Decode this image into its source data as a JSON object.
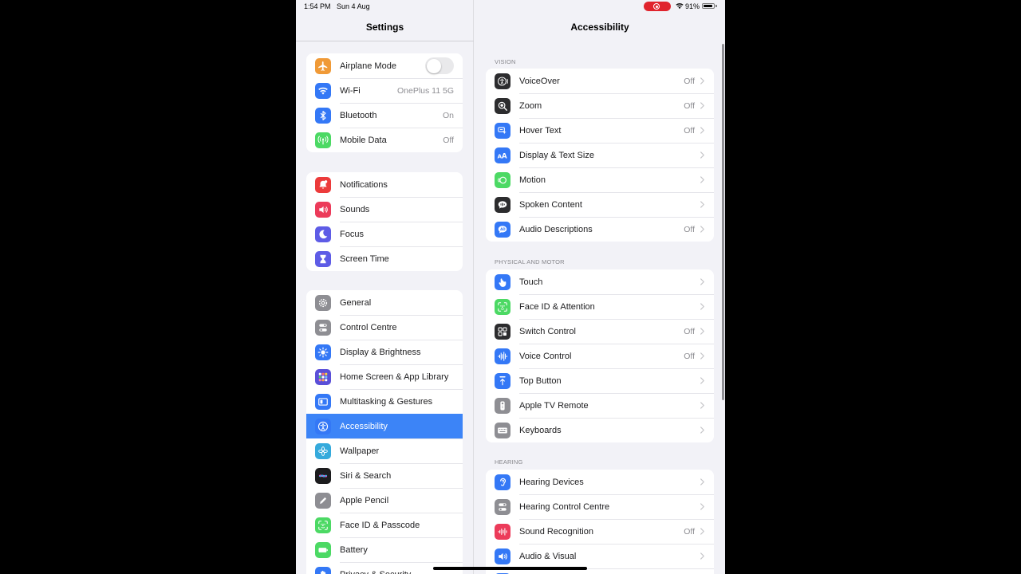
{
  "status_bar": {
    "time": "1:54 PM",
    "date": "Sun 4 Aug",
    "battery": "91%",
    "battery_level": 0.91
  },
  "sidebar": {
    "title": "Settings",
    "groups": [
      [
        {
          "name": "airplane-mode",
          "label": "Airplane Mode",
          "icon": "airplane-icon",
          "color": "#f09a37",
          "toggle": false
        },
        {
          "name": "wifi",
          "label": "Wi-Fi",
          "value": "OnePlus 11 5G",
          "icon": "wifi-icon",
          "color": "#3478f6"
        },
        {
          "name": "bluetooth",
          "label": "Bluetooth",
          "value": "On",
          "icon": "bluetooth-icon",
          "color": "#3478f6"
        },
        {
          "name": "mobile-data",
          "label": "Mobile Data",
          "value": "Off",
          "icon": "antenna-icon",
          "color": "#4cd964"
        }
      ],
      [
        {
          "name": "notifications",
          "label": "Notifications",
          "icon": "bell-icon",
          "color": "#ec3b3b"
        },
        {
          "name": "sounds",
          "label": "Sounds",
          "icon": "speaker-icon",
          "color": "#ec3b5a"
        },
        {
          "name": "focus",
          "label": "Focus",
          "icon": "moon-icon",
          "color": "#5e5ce6"
        },
        {
          "name": "screen-time",
          "label": "Screen Time",
          "icon": "hourglass-icon",
          "color": "#5e5ce6"
        }
      ],
      [
        {
          "name": "general",
          "label": "General",
          "icon": "gear-icon",
          "color": "#8e8e93"
        },
        {
          "name": "control-centre",
          "label": "Control Centre",
          "icon": "switches-icon",
          "color": "#8e8e93"
        },
        {
          "name": "display-brightness",
          "label": "Display & Brightness",
          "icon": "sun-icon",
          "color": "#3478f6"
        },
        {
          "name": "home-screen",
          "label": "Home Screen & App Library",
          "icon": "app-grid-icon",
          "color": "#5a4fd8"
        },
        {
          "name": "multitasking",
          "label": "Multitasking & Gestures",
          "icon": "multitask-icon",
          "color": "#3478f6"
        },
        {
          "name": "accessibility",
          "label": "Accessibility",
          "icon": "accessibility-icon",
          "color": "#3478f6",
          "selected": true
        },
        {
          "name": "wallpaper",
          "label": "Wallpaper",
          "icon": "flower-icon",
          "color": "#35aadc"
        },
        {
          "name": "siri-search",
          "label": "Siri & Search",
          "icon": "siri-icon",
          "color": "#1c1c1e"
        },
        {
          "name": "apple-pencil",
          "label": "Apple Pencil",
          "icon": "pencil-icon",
          "color": "#8e8e93"
        },
        {
          "name": "face-id-passcode",
          "label": "Face ID & Passcode",
          "icon": "face-id-icon",
          "color": "#4cd964"
        },
        {
          "name": "battery",
          "label": "Battery",
          "icon": "battery-icon",
          "color": "#4cd964"
        },
        {
          "name": "privacy-security",
          "label": "Privacy & Security",
          "icon": "hand-icon",
          "color": "#3478f6"
        }
      ]
    ]
  },
  "detail": {
    "title": "Accessibility",
    "sections": [
      {
        "header": "VISION",
        "rows": [
          {
            "name": "voiceover",
            "label": "VoiceOver",
            "value": "Off",
            "icon": "voiceover-icon",
            "color": "#2c2c2e"
          },
          {
            "name": "zoom",
            "label": "Zoom",
            "value": "Off",
            "icon": "zoom-icon",
            "color": "#2c2c2e"
          },
          {
            "name": "hover-text",
            "label": "Hover Text",
            "value": "Off",
            "icon": "hover-text-icon",
            "color": "#3478f6"
          },
          {
            "name": "display-text-size",
            "label": "Display & Text Size",
            "icon": "text-size-icon",
            "color": "#3478f6"
          },
          {
            "name": "motion",
            "label": "Motion",
            "icon": "motion-icon",
            "color": "#4cd964"
          },
          {
            "name": "spoken-content",
            "label": "Spoken Content",
            "icon": "speech-bubble-icon",
            "color": "#2c2c2e"
          },
          {
            "name": "audio-descriptions",
            "label": "Audio Descriptions",
            "value": "Off",
            "icon": "audio-description-icon",
            "color": "#3478f6"
          }
        ]
      },
      {
        "header": "PHYSICAL AND MOTOR",
        "rows": [
          {
            "name": "touch",
            "label": "Touch",
            "icon": "touch-hand-icon",
            "color": "#3478f6"
          },
          {
            "name": "face-id-attention",
            "label": "Face ID & Attention",
            "icon": "face-id-icon",
            "color": "#4cd964"
          },
          {
            "name": "switch-control",
            "label": "Switch Control",
            "value": "Off",
            "icon": "switch-grid-icon",
            "color": "#2c2c2e"
          },
          {
            "name": "voice-control",
            "label": "Voice Control",
            "value": "Off",
            "icon": "waveform-icon",
            "color": "#3478f6"
          },
          {
            "name": "top-button",
            "label": "Top Button",
            "icon": "top-button-icon",
            "color": "#3478f6"
          },
          {
            "name": "apple-tv-remote",
            "label": "Apple TV Remote",
            "icon": "remote-icon",
            "color": "#8e8e93"
          },
          {
            "name": "keyboards",
            "label": "Keyboards",
            "icon": "keyboard-icon",
            "color": "#8e8e93"
          }
        ]
      },
      {
        "header": "HEARING",
        "rows": [
          {
            "name": "hearing-devices",
            "label": "Hearing Devices",
            "icon": "ear-icon",
            "color": "#3478f6"
          },
          {
            "name": "hearing-control-centre",
            "label": "Hearing Control Centre",
            "icon": "switches-icon",
            "color": "#8e8e93"
          },
          {
            "name": "sound-recognition",
            "label": "Sound Recognition",
            "value": "Off",
            "icon": "sound-wave-icon",
            "color": "#ec3b5a"
          },
          {
            "name": "audio-visual",
            "label": "Audio & Visual",
            "icon": "speaker-eye-icon",
            "color": "#3478f6"
          },
          {
            "name": "subtitles",
            "label": "",
            "icon": "captions-icon",
            "color": "#3478f6"
          }
        ]
      }
    ]
  }
}
